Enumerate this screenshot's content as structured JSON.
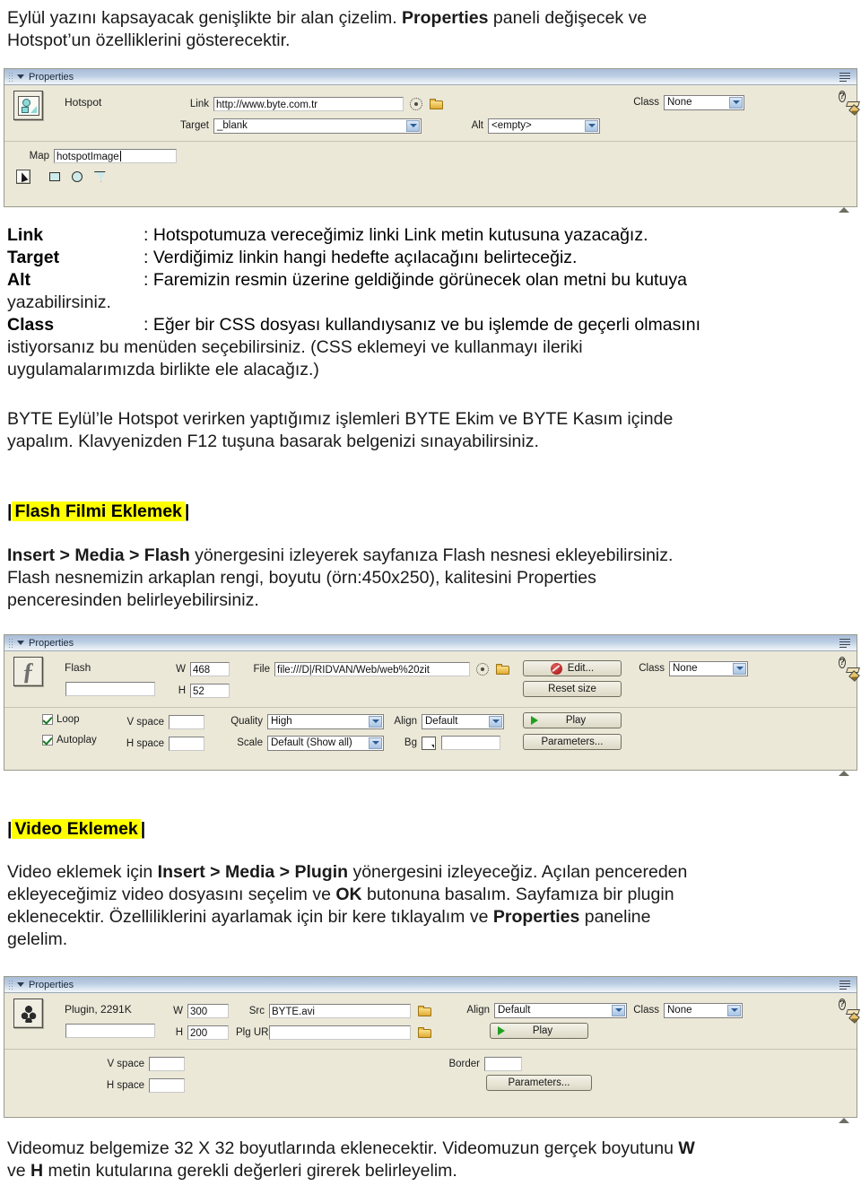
{
  "intro": {
    "line1_a": "Eylül yazını kapsayacak genişlikte bir alan çizelim. ",
    "line1_bold": "Properties",
    "line1_b": " paneli değişecek ve",
    "line2": "Hotspot’un özelliklerini gösterecektir."
  },
  "hotspot_panel": {
    "title": "Properties",
    "object_label": "Hotspot",
    "link_label": "Link",
    "link_value": "http://www.byte.com.tr",
    "target_label": "Target",
    "target_value": "_blank",
    "alt_label": "Alt",
    "alt_value": "<empty>",
    "class_label": "Class",
    "class_value": "None",
    "map_label": "Map",
    "map_value": "hotspotImage",
    "icons": {
      "object": "hotspot-icon",
      "point_to_file": "target-crosshair-icon",
      "browse_folder": "folder-icon",
      "help": "?",
      "edit": "pencil-icon",
      "panel_menu": "hamburger-menu-icon"
    },
    "tools": [
      "pointer-tool",
      "rectangle-hotspot-tool",
      "oval-hotspot-tool",
      "polygon-hotspot-tool"
    ]
  },
  "definitions": [
    {
      "term": "Link",
      "desc": ": Hotspotumuza vereceğimiz linki Link metin kutusuna yazacağız."
    },
    {
      "term": "Target",
      "desc": ": Verdiğimiz linkin hangi hedefte açılacağını belirteceğiz."
    },
    {
      "term": "Alt",
      "desc": ": Faremizin resmin üzerine geldiğinde görünecek olan metni bu kutuya"
    }
  ],
  "def_alt_cont": "yazabilirsiniz.",
  "class_def": {
    "term": "Class",
    "line1": ": Eğer bir CSS dosyası kullandıysanız ve bu işlemde de geçerli olmasını",
    "line2": "istiyorsanız bu menüden seçebilirsiniz. (CSS eklemeyi ve kullanmayı ileriki",
    "line3": "uygulamalarımızda birlikte ele alacağız.)"
  },
  "byte_para": {
    "line1": "BYTE Eylül’le Hotspot verirken yaptığımız işlemleri BYTE Ekim ve BYTE Kasım içinde",
    "line2": "yapalım. Klavyenizden  F12 tuşuna basarak belgenizi sınayabilirsiniz."
  },
  "flash_section": {
    "heading_bar_left": "|",
    "heading": "Flash Filmi Eklemek",
    "heading_bar_right": "|",
    "para_bold": "Insert > Media > Flash",
    "para_rest1": " yönergesini izleyerek sayfanıza Flash nesnesi ekleyebilirsiniz.",
    "para_line2": "Flash nesnemizin arkaplan rengi, boyutu (örn:450x250), kalitesini Properties",
    "para_line3": "penceresinden belirleyebilirsiniz."
  },
  "flash_panel": {
    "title": "Properties",
    "object_label": "Flash",
    "name_value": "",
    "w_label": "W",
    "w_value": "468",
    "h_label": "H",
    "h_value": "52",
    "file_label": "File",
    "file_value": "file:///D|/RIDVAN/Web/web%20zit",
    "edit_button": "Edit...",
    "reset_button": "Reset size",
    "class_label": "Class",
    "class_value": "None",
    "loop_label": "Loop",
    "loop_checked": true,
    "autoplay_label": "Autoplay",
    "autoplay_checked": true,
    "vspace_label": "V space",
    "vspace_value": "",
    "hspace_label": "H space",
    "hspace_value": "",
    "quality_label": "Quality",
    "quality_value": "High",
    "scale_label": "Scale",
    "scale_value": "Default (Show all)",
    "align_label": "Align",
    "align_value": "Default",
    "bg_label": "Bg",
    "bg_value": "",
    "play_button": "Play",
    "parameters_button": "Parameters..."
  },
  "video_section": {
    "heading_bar_left": "|",
    "heading": "Video Eklemek",
    "heading_bar_right": "|",
    "p_a": "Video eklemek için ",
    "p_bold1": "Insert > Media > Plugin",
    "p_b": " yönergesini izleyeceğiz. Açılan pencereden",
    "p_c": "ekleyeceğimiz video dosyasını seçelim ve ",
    "p_bold2": "OK",
    "p_d": " butonuna basalım. Sayfamıza bir plugin",
    "p_e": "eklenecektir. Özelliliklerini ayarlamak için bir kere tıklayalım ve ",
    "p_bold3": "Properties",
    "p_f": " paneline",
    "p_g": "gelelim."
  },
  "plugin_panel": {
    "title": "Properties",
    "object_label": "Plugin, 2291K",
    "name_value": "",
    "w_label": "W",
    "w_value": "300",
    "h_label": "H",
    "h_value": "200",
    "src_label": "Src",
    "src_value": "BYTE.avi",
    "plg_url_label": "Plg URL",
    "plg_url_value": "",
    "align_label": "Align",
    "align_value": "Default",
    "class_label": "Class",
    "class_value": "None",
    "play_button": "Play",
    "vspace_label": "V space",
    "vspace_value": "",
    "hspace_label": "H space",
    "hspace_value": "",
    "border_label": "Border",
    "border_value": "",
    "parameters_button": "Parameters..."
  },
  "closing": {
    "line1_a": "Videomuz belgemize 32 X 32  boyutlarında eklenecektir. Videomuzun gerçek boyutunu ",
    "line1_bold": "W",
    "line2_a": "ve ",
    "line2_bold": "H",
    "line2_b": " metin kutularına gerekli değerleri girerek belirleyelim."
  },
  "colors": {
    "panel_bg": "#ebe8d8",
    "panel_title_blue": "#b0c4de",
    "highlight_yellow": "#ffff00",
    "accent_green": "#1fa01f"
  }
}
